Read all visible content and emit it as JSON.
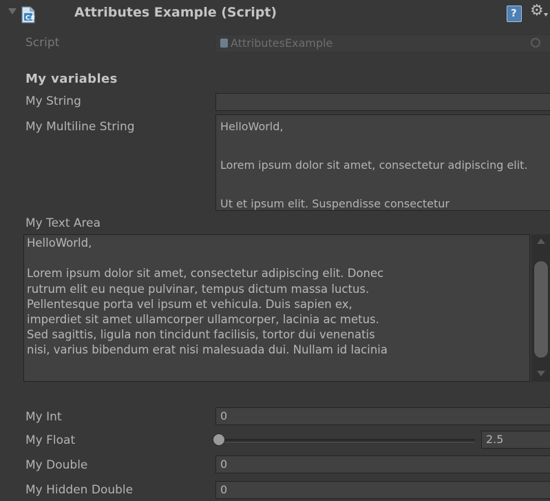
{
  "header": {
    "title": "Attributes Example (Script)",
    "help_glyph": "?",
    "icons": [
      "foldout-arrow",
      "script-icon",
      "help-icon",
      "gear-icon"
    ]
  },
  "script_row": {
    "label": "Script",
    "value": "AttributesExample"
  },
  "section_header": "My variables",
  "fields": {
    "my_string": {
      "label": "My String",
      "value": ""
    },
    "my_multiline": {
      "label": "My Multiline String",
      "lines": [
        "HelloWorld,",
        "",
        "Lorem ipsum dolor sit amet, consectetur adipiscing elit.",
        "",
        "Ut et ipsum elit. Suspendisse consectetur"
      ]
    },
    "my_text_area": {
      "label": "My Text Area",
      "text": "HelloWorld,\n\nLorem ipsum dolor sit amet, consectetur adipiscing elit. Donec\nrutrum elit eu neque pulvinar, tempus dictum massa luctus.\nPellentesque porta vel ipsum et vehicula. Duis sapien ex,\nimperdiet sit amet ullamcorper ullamcorper, lacinia ac metus.\nSed sagittis, ligula non tincidunt facilisis, tortor dui venenatis\nnisi, varius bibendum erat nisi malesuada dui. Nullam id lacinia"
    },
    "my_int": {
      "label": "My Int",
      "value": "0"
    },
    "my_float": {
      "label": "My Float",
      "value": "2.5",
      "slider_fraction": 0.0
    },
    "my_double": {
      "label": "My Double",
      "value": "0"
    },
    "my_hidden_double": {
      "label": "My Hidden Double",
      "value": "0"
    }
  },
  "colors": {
    "background": "#383838",
    "field": "#414141",
    "help_icon": "#4f7fb3"
  }
}
